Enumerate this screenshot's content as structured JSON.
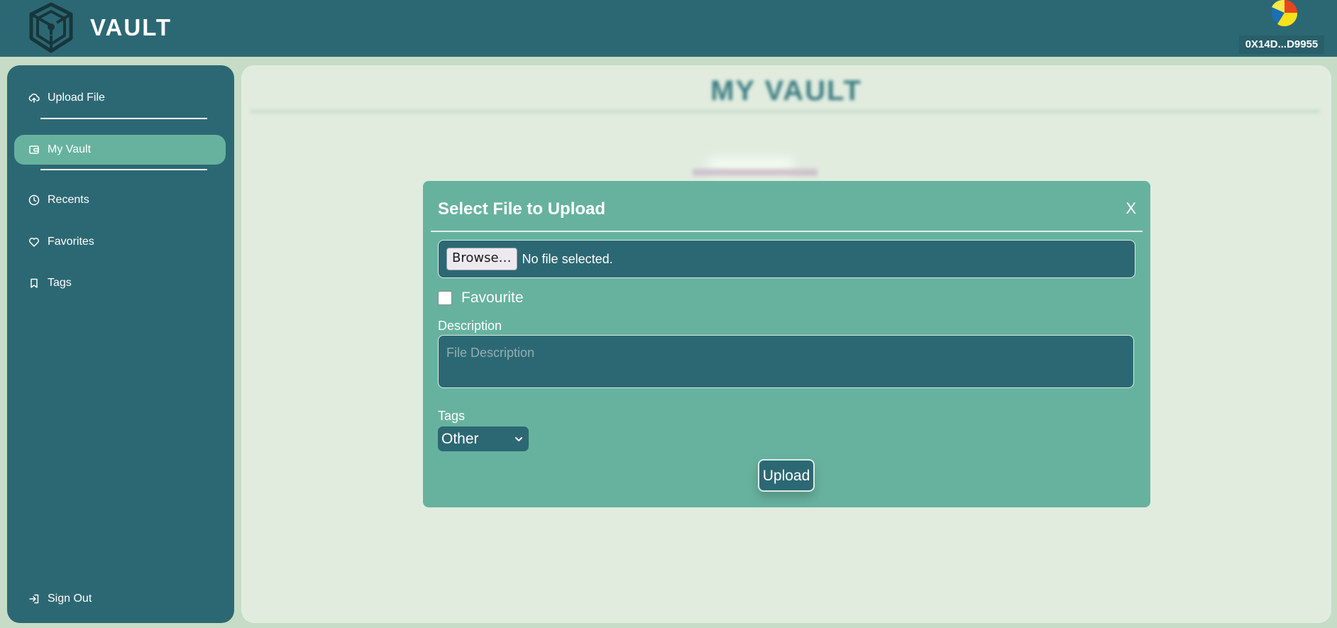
{
  "header": {
    "app_title": "VAULT",
    "account_address": "0X14D...D9955"
  },
  "sidebar": {
    "items": [
      {
        "label": "Upload File",
        "icon": "cloud-upload-icon"
      },
      {
        "label": "My Vault",
        "icon": "wallet-icon",
        "active": true
      },
      {
        "label": "Recents",
        "icon": "clock-icon"
      },
      {
        "label": "Favorites",
        "icon": "heart-icon"
      },
      {
        "label": "Tags",
        "icon": "bookmark-icon"
      }
    ],
    "sign_out": {
      "label": "Sign Out",
      "icon": "sign-out-icon"
    }
  },
  "main": {
    "title": "MY VAULT"
  },
  "modal": {
    "title": "Select File to Upload",
    "close_label": "X",
    "browse_label": "Browse…",
    "file_status": "No file selected.",
    "favourite_label": "Favourite",
    "favourite_checked": false,
    "description_label": "Description",
    "description_placeholder": "File Description",
    "description_value": "",
    "tags_label": "Tags",
    "tags_selected": "Other",
    "upload_label": "Upload"
  },
  "colors": {
    "primary": "#2c6873",
    "accent": "#67b29f",
    "background": "#e1ecdf"
  }
}
